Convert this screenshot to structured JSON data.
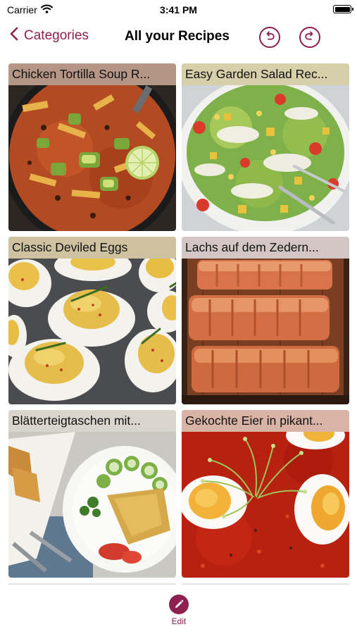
{
  "status": {
    "carrier": "Carrier",
    "time": "3:41 PM"
  },
  "nav": {
    "back_label": "Categories",
    "title": "All your Recipes"
  },
  "recipes": [
    {
      "title": "Chicken Tortilla Soup R..."
    },
    {
      "title": "Easy Garden Salad Rec..."
    },
    {
      "title": "Classic Deviled Eggs"
    },
    {
      "title": "Lachs auf dem Zedern..."
    },
    {
      "title": "Blätterteigtaschen mit..."
    },
    {
      "title": "Gekochte Eier in pikant..."
    }
  ],
  "toolbar": {
    "edit_label": "Edit"
  },
  "colors": {
    "accent": "#8e1f4f"
  }
}
